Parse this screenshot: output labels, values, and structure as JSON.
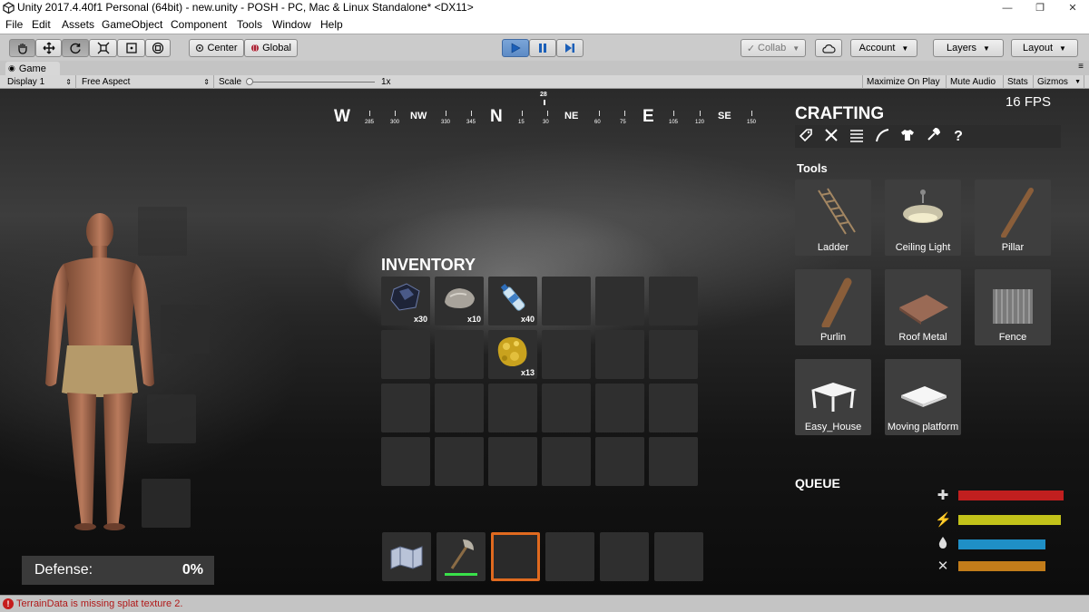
{
  "window": {
    "title": "Unity 2017.4.40f1 Personal (64bit) - new.unity - POSH - PC, Mac & Linux Standalone* <DX11>",
    "minimize": "—",
    "maximize": "❐",
    "close": "✕"
  },
  "menu": [
    "File",
    "Edit",
    "Assets",
    "GameObject",
    "Component",
    "Tools",
    "Window",
    "Help"
  ],
  "toolbar": {
    "pivot_label": "Center",
    "space_label": "Global",
    "collab_label": "Collab",
    "account_label": "Account",
    "layers_label": "Layers",
    "layout_label": "Layout"
  },
  "game_view": {
    "tab_label": "Game",
    "display": "Display 1",
    "aspect": "Free Aspect",
    "scale_label": "Scale",
    "scale_value": "1x",
    "maximize_on_play": "Maximize On Play",
    "mute_audio": "Mute Audio",
    "stats": "Stats",
    "gizmos": "Gizmos"
  },
  "hud": {
    "fps": "16 FPS",
    "compass": {
      "cardinals": [
        "W",
        "N",
        "E"
      ],
      "intercardinals": [
        "NW",
        "NE",
        "SE"
      ],
      "degrees": [
        "285",
        "300",
        "330",
        "345",
        "15",
        "30",
        "60",
        "75",
        "105",
        "120",
        "150"
      ],
      "current_heading": "28"
    },
    "defense_label": "Defense:",
    "defense_value": "0%"
  },
  "inventory": {
    "title": "INVENTORY",
    "items": [
      {
        "name": "coal",
        "qty": "x30"
      },
      {
        "name": "stone",
        "qty": "x10"
      },
      {
        "name": "water-bottle",
        "qty": "x40"
      },
      {
        "name": "gold-ore",
        "qty": "x13"
      }
    ],
    "hotbar": [
      "map",
      "stone-axe",
      "selected-empty",
      "empty",
      "empty",
      "empty"
    ]
  },
  "crafting": {
    "title": "CRAFTING",
    "category_icons": [
      "tag-icon",
      "tools-icon",
      "list-icon",
      "bow-icon",
      "shirt-icon",
      "dropper-icon",
      "help-icon"
    ],
    "help_glyph": "?",
    "section_label": "Tools",
    "recipes": [
      "Ladder",
      "Ceiling Light",
      "Pillar",
      "Purlin",
      "Roof Metal",
      "Fence",
      "Easy_House",
      "Moving platform"
    ],
    "queue_label": "QUEUE"
  },
  "stats": [
    {
      "name": "health",
      "icon": "plus-icon",
      "glyph": "✚",
      "color": "#c11f1f",
      "level": 1.0
    },
    {
      "name": "energy",
      "icon": "lightning-icon",
      "glyph": "⚡",
      "color": "#c2c21a",
      "level": 0.97
    },
    {
      "name": "thirst",
      "icon": "water-drop-icon",
      "glyph": "💧",
      "color": "#1f8fc6",
      "level": 0.83
    },
    {
      "name": "hunger",
      "icon": "fork-knife-icon",
      "glyph": "✕",
      "color": "#c27c1a",
      "level": 0.83
    }
  ],
  "status_bar": {
    "message": "TerrainData is missing splat texture 2."
  }
}
